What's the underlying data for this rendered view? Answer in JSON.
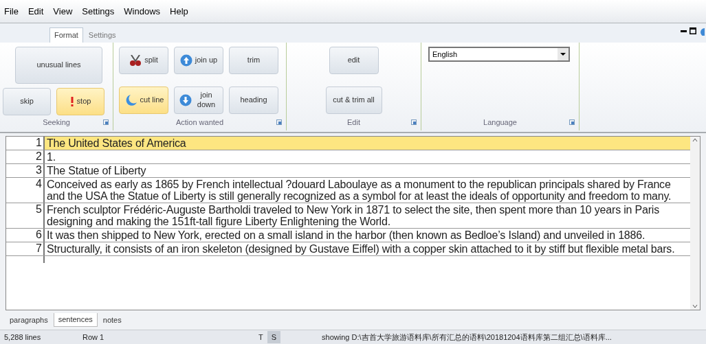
{
  "menu": [
    "File",
    "Edit",
    "View",
    "Settings",
    "Windows",
    "Help"
  ],
  "ribbon_tabs": [
    {
      "label": "Format",
      "selected": true
    },
    {
      "label": "Settings",
      "selected": false
    }
  ],
  "groups": [
    {
      "title": "Seeking",
      "buttons": [
        {
          "label": "unusual lines",
          "active": false
        },
        {
          "label": "skip",
          "active": false
        },
        {
          "label": "stop",
          "active": true
        }
      ]
    },
    {
      "title": "Action wanted",
      "buttons": [
        {
          "label": "split",
          "active": false
        },
        {
          "label": "join up",
          "active": false
        },
        {
          "label": "trim",
          "active": false
        },
        {
          "label": "cut line",
          "active": true
        },
        {
          "label": "join down",
          "active": false
        },
        {
          "label": "heading",
          "active": false
        }
      ]
    },
    {
      "title": "Edit",
      "buttons": [
        {
          "label": "edit",
          "active": false
        },
        {
          "label": "cut & trim all",
          "active": false
        }
      ]
    },
    {
      "title": "Language",
      "select": "English"
    }
  ],
  "rows": [
    {
      "number": "1",
      "text": "The United States of America",
      "selected": true
    },
    {
      "number": "2",
      "text": "1.",
      "selected": false
    },
    {
      "number": "3",
      "text": "The Statue of Liberty",
      "selected": false
    },
    {
      "number": "4",
      "text": "Conceived as early as 1865 by French intellectual ?douard Laboulaye as a monument to the republican principals shared by France and the USA the Statue of Liberty is still generally recognized as a symbol for at least the ideals of opportunity and freedom to many.",
      "selected": false
    },
    {
      "number": "5",
      "text": "French sculptor Frédéric-Auguste Bartholdi traveled to New York in 1871 to select the site, then spent more than 10 years in Paris designing and making the 151ft-tall figure Liberty Enlightening the World.",
      "selected": false
    },
    {
      "number": "6",
      "text": "It was then shipped to New York, erected on a small island in the harbor (then known as Bedloe’s Island) and unveiled in 1886.",
      "selected": false
    },
    {
      "number": "7",
      "text": "Structurally, it consists of an iron skeleton (designed by Gustave Eiffel) with a copper skin attached to it by stiff but flexible metal bars.",
      "selected": false
    }
  ],
  "bottom_tabs": [
    {
      "label": "paragraphs",
      "selected": false
    },
    {
      "label": "sentences",
      "selected": true
    },
    {
      "label": "notes",
      "selected": false
    }
  ],
  "status_bar": {
    "lines": "5,288 lines",
    "row": "Row 1",
    "toggles": [
      {
        "label": "T",
        "selected": false
      },
      {
        "label": "S",
        "selected": true
      }
    ],
    "path": "showing D:\\吉首大学旅游语料库\\所有汇总的语料\\20181204语料库第二组汇总\\语料库..."
  }
}
